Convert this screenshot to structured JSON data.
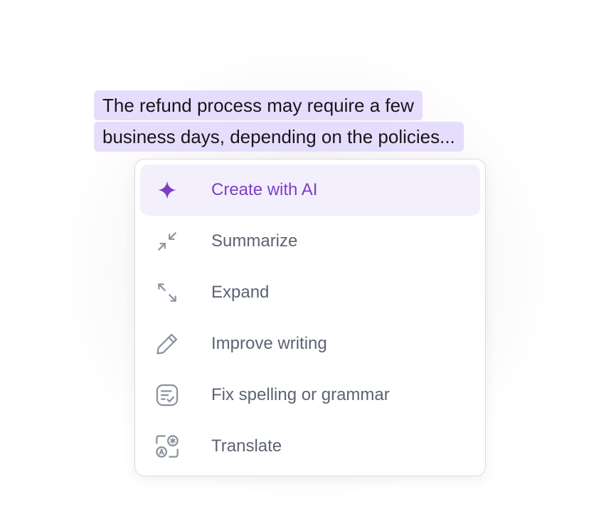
{
  "selection": {
    "line1": "The refund process may require a few",
    "line2": "business days, depending on the policies..."
  },
  "menu": {
    "items": [
      {
        "label": "Create with AI",
        "icon": "sparkle-icon",
        "active": true
      },
      {
        "label": "Summarize",
        "icon": "collapse-arrows-icon",
        "active": false
      },
      {
        "label": "Expand",
        "icon": "expand-arrows-icon",
        "active": false
      },
      {
        "label": "Improve writing",
        "icon": "pencil-icon",
        "active": false
      },
      {
        "label": "Fix spelling or grammar",
        "icon": "text-check-icon",
        "active": false
      },
      {
        "label": "Translate",
        "icon": "translate-icon",
        "active": false
      }
    ]
  },
  "colors": {
    "accent": "#7d3ec5",
    "highlight": "#e5ddfb",
    "active_bg": "#f3effd",
    "item_text": "#5c6374",
    "icon_gray": "#8b91a0"
  }
}
